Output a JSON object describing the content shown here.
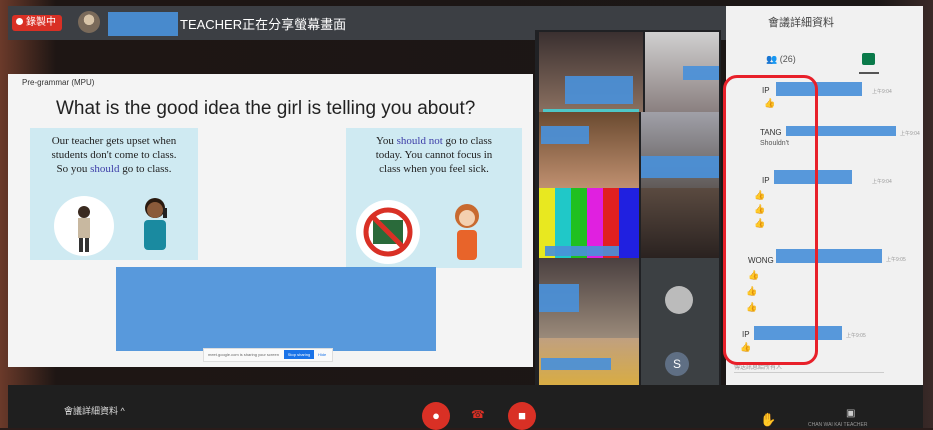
{
  "topbar": {
    "recording_label": "錄製中",
    "presenting_text": "TEACHER正在分享螢幕畫面"
  },
  "slide": {
    "label": "Pre-grammar (MPU)",
    "question": "What is the good idea the girl is telling you about?",
    "left_quote": {
      "line1": "Our teacher gets upset when",
      "line2": "students don't come to class.",
      "line3_pre": "So you ",
      "line3_hl": "should",
      "line3_post": " go to class."
    },
    "right_quote": {
      "line1_pre": "You ",
      "line1_hl": "should not",
      "line1_post": " go to class",
      "line2": "today. You cannot focus in",
      "line3": "class when you feel sick."
    },
    "share_bar": {
      "text": "meet.google.com is sharing your screen",
      "stop_label": "Stop sharing",
      "hide_label": "Hide"
    }
  },
  "tiles": {
    "avatar_letter": "S"
  },
  "panel": {
    "title": "會議詳細資料",
    "people_count": "(26)",
    "messages": [
      {
        "name": "IP",
        "time": "上午9:04",
        "text": "",
        "reactions": 1
      },
      {
        "name": "TANG",
        "time": "上午9:04",
        "text": "Shouldn't",
        "reactions": 0
      },
      {
        "name": "IP",
        "time": "上午9:04",
        "text": "",
        "reactions": 3
      },
      {
        "name": "WONG",
        "time": "上午9:05",
        "text": "",
        "reactions": 3
      },
      {
        "name": "IP",
        "time": "上午9:05",
        "text": "",
        "reactions": 1
      }
    ],
    "input_placeholder": "傳送訊息給所有人"
  },
  "bottombar": {
    "meeting_details": "會議詳細資料 ^",
    "present_label": "CHAN WAI KAI TEACHER"
  },
  "colors": {
    "blur": "#4a90d9",
    "red": "#d93025",
    "annotation": "#e8202a",
    "chat_tab": "#0a7a4a"
  }
}
